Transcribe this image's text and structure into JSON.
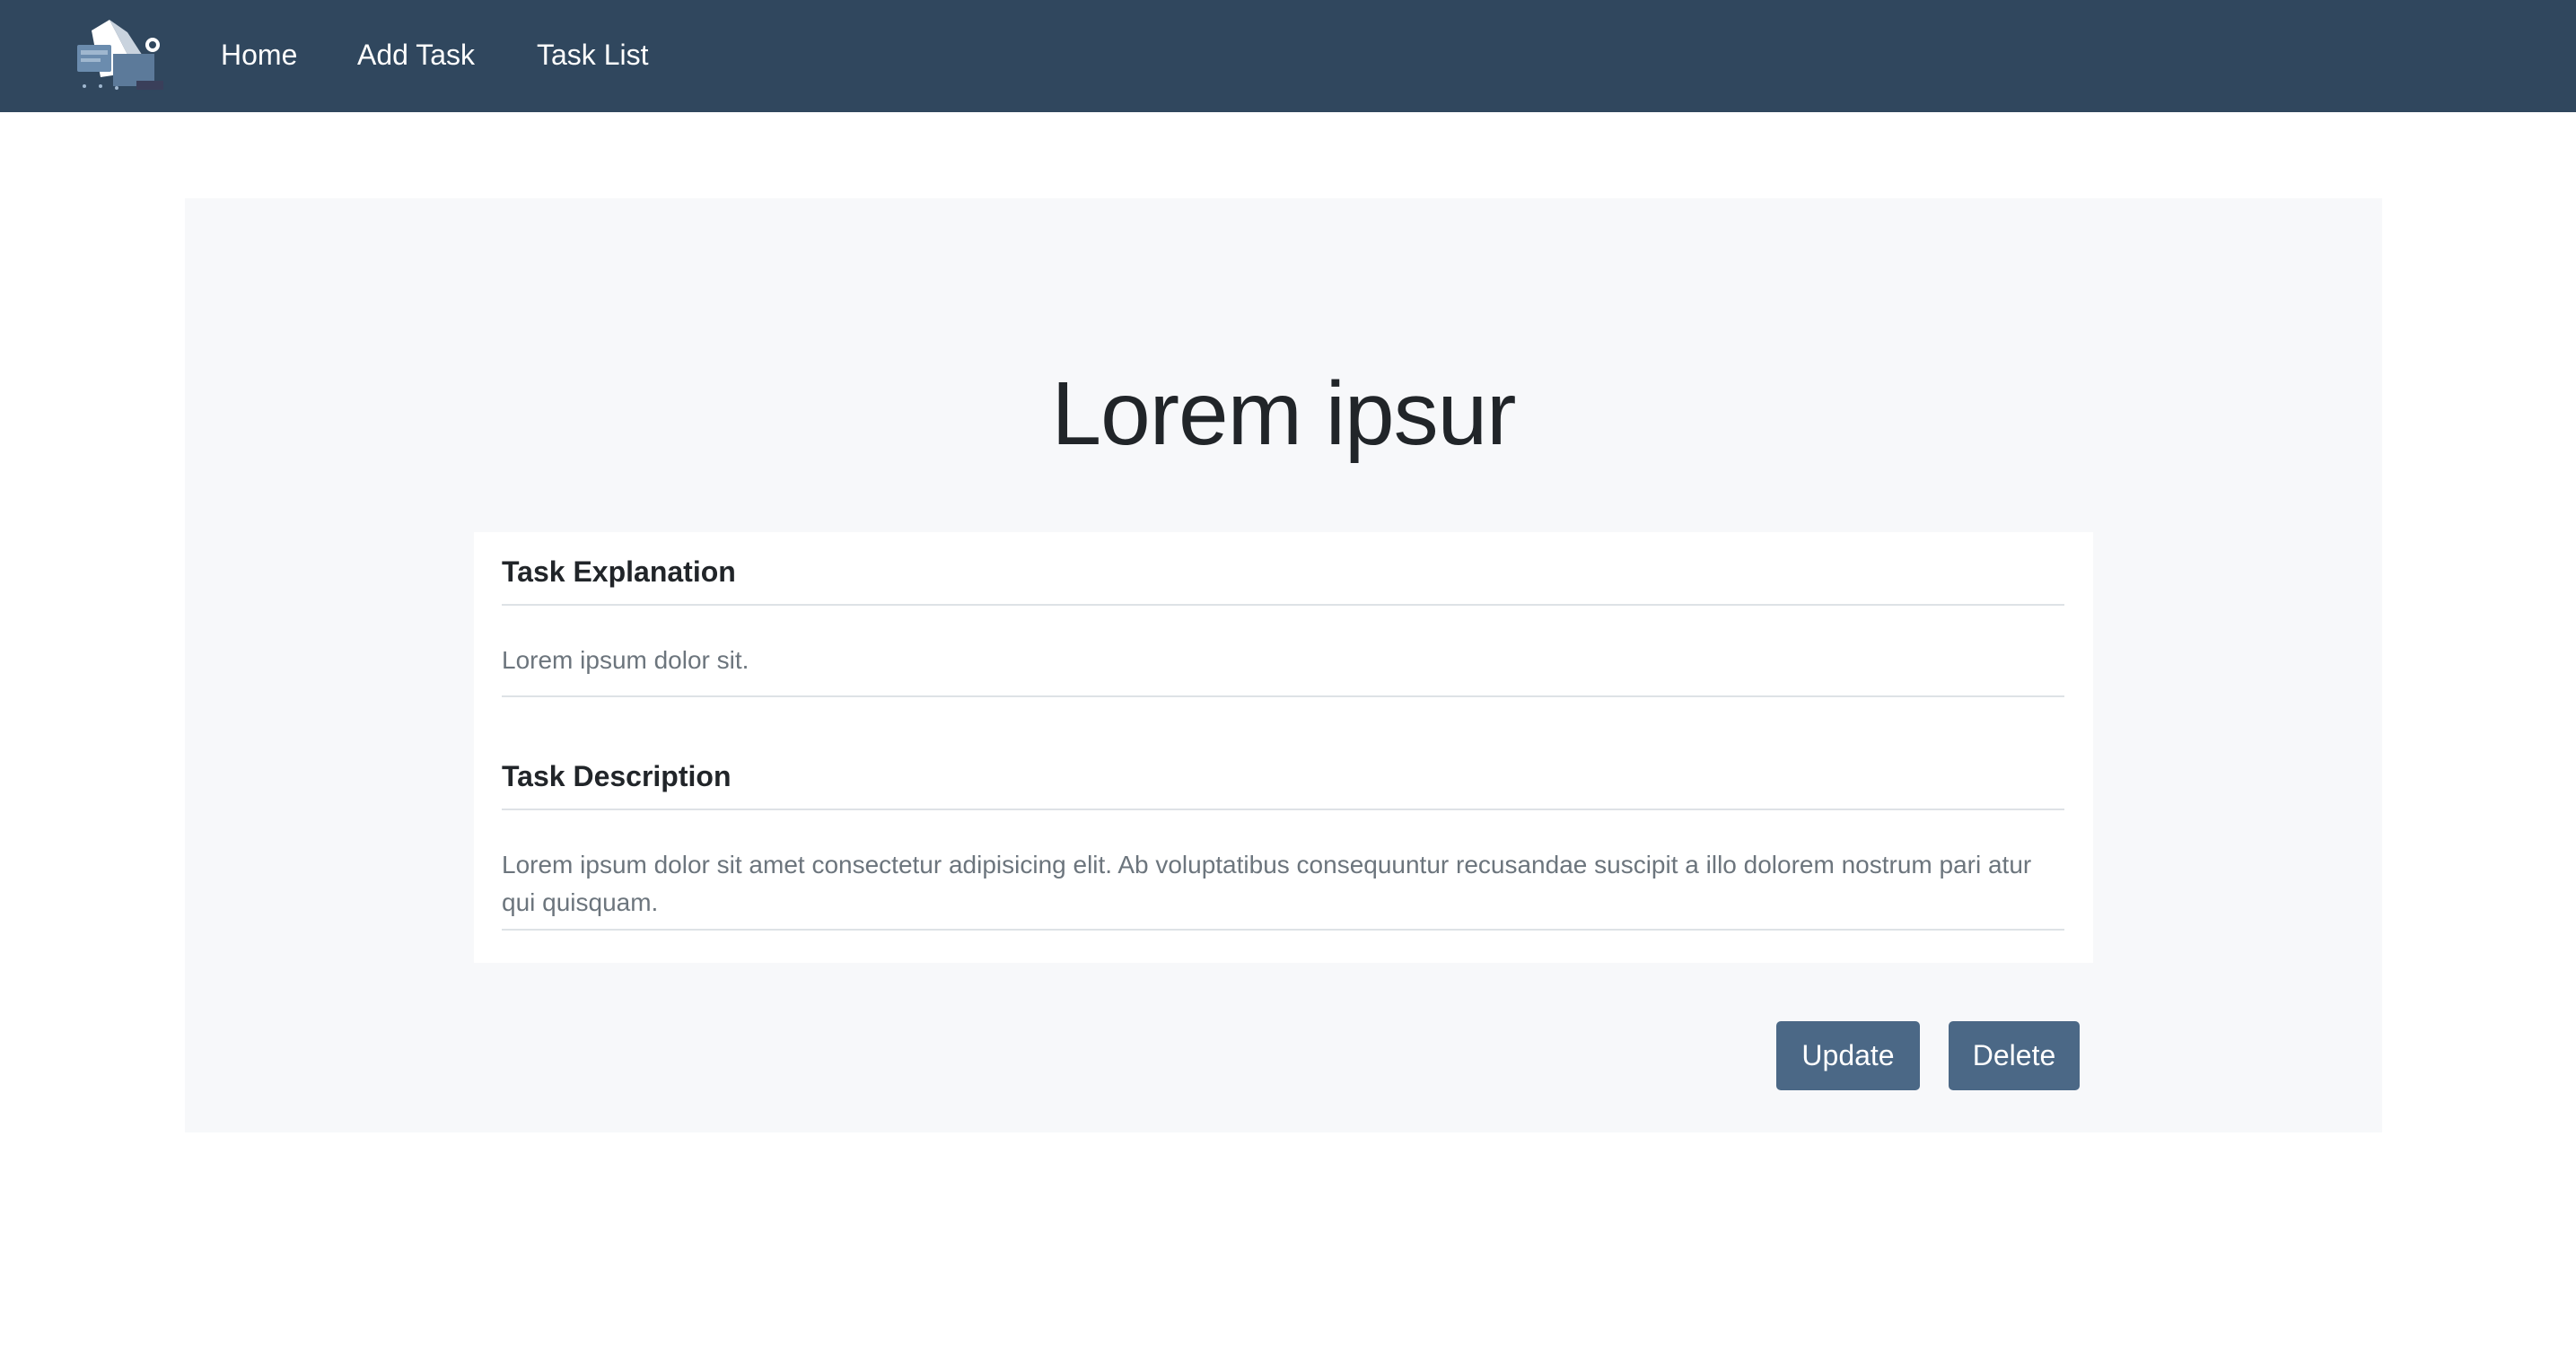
{
  "navbar": {
    "links": [
      {
        "label": "Home"
      },
      {
        "label": "Add Task"
      },
      {
        "label": "Task List"
      }
    ]
  },
  "task": {
    "title": "Lorem ipsur",
    "explanation_heading": "Task Explanation",
    "explanation_text": "Lorem ipsum dolor sit.",
    "description_heading": "Task Description",
    "description_text": "Lorem ipsum dolor sit amet consectetur adipisicing elit. Ab voluptatibus consequuntur recusandae suscipit a illo dolorem nostrum pari atur qui quisquam."
  },
  "actions": {
    "update_label": "Update",
    "delete_label": "Delete"
  },
  "colors": {
    "navbar_bg": "#30475e",
    "button_bg": "#4b6886",
    "panel_bg": "#f7f8fa"
  },
  "icons": {
    "brand": "task-manager-logo-icon"
  }
}
